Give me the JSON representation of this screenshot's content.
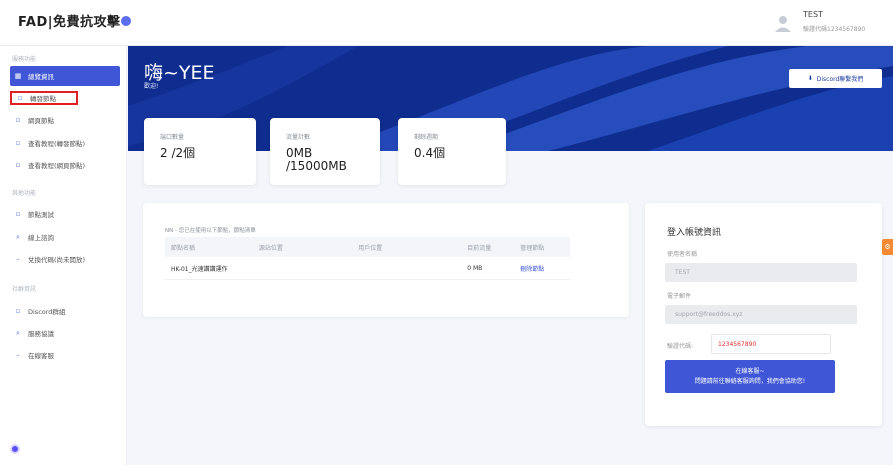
{
  "topbar": {
    "logo": "FAD|免費抗攻擊",
    "user_name": "TEST",
    "user_sub": "驗證代碼1234567890"
  },
  "sidebar": {
    "sections": [
      {
        "title": "服務功能",
        "items": [
          {
            "label": "總覽資訊",
            "icon": "grid-icon",
            "active": true
          },
          {
            "label": "轉發節點",
            "icon": "doc-icon",
            "highlight": true
          },
          {
            "label": "網頁節點",
            "icon": "doc-icon"
          },
          {
            "label": "查看教程(轉發節點)",
            "icon": "doc-icon"
          },
          {
            "label": "查看教程(網頁節點)",
            "icon": "doc-icon"
          }
        ]
      },
      {
        "title": "其他功能",
        "items": [
          {
            "label": "節點測試",
            "icon": "doc-icon"
          },
          {
            "label": "線上諮詢",
            "icon": "search-icon"
          },
          {
            "label": "兌換代碼(尚未開放)",
            "icon": "dash-icon"
          }
        ]
      },
      {
        "title": "社群資訊",
        "items": [
          {
            "label": "Discord群組",
            "icon": "doc-icon"
          },
          {
            "label": "服務協議",
            "icon": "search-icon"
          },
          {
            "label": "在線客服",
            "icon": "dash-icon"
          }
        ]
      }
    ]
  },
  "hero": {
    "title": "嗨~YEE",
    "subtitle": "歡迎!",
    "discord_button": "Discord聯繫我們"
  },
  "stats": [
    {
      "label": "端口數量",
      "value": "2 /2個"
    },
    {
      "label": "流量計數",
      "value": "0MB\n/15000MB"
    },
    {
      "label": "剩餘週期",
      "value": "0.4個"
    }
  ],
  "nodes_panel": {
    "note": "NN - 您已在使用以下節點，節點清單",
    "headers": [
      "節點名稱",
      "源站位置",
      "用戶位置",
      "目前流量",
      "管理節點"
    ],
    "rows": [
      [
        "HK-01_光速讚讚運作",
        "",
        "",
        "0 MB",
        "刪除節點"
      ]
    ]
  },
  "login_info": {
    "title": "登入帳號資訊",
    "username_label": "使用者名稱",
    "username_value": "TEST",
    "email_label": "電子郵件",
    "email_value": "support@freeddos.xyz",
    "verify_label": "驗證代碼:",
    "verify_value": "1234567890",
    "button_line1": "在線客服~",
    "button_line2": "問題請前往聯絡客服詢問，我們會協助您!"
  },
  "colors": {
    "accent": "#3f56d6",
    "hero_bg": "#0f2d8f",
    "highlight_border": "#e02020",
    "side_tab": "#f58a33"
  }
}
